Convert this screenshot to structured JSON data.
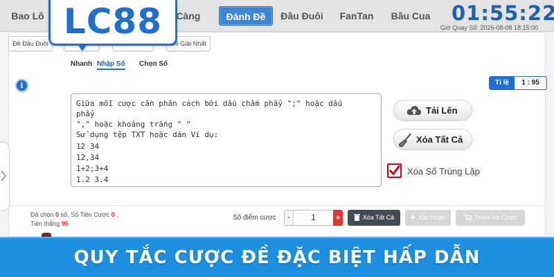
{
  "nav": {
    "tabs": [
      "Bao Lô",
      "3 Càng",
      "Đánh Đề",
      "Đầu Đuôi",
      "FanTan",
      "Bầu Cua"
    ],
    "active_tab": "Đánh Đề"
  },
  "logo": {
    "text": "LC88"
  },
  "clock": {
    "countdown": "01:55:22",
    "draw_time": "Giờ Quay Số: 2026-08-08 18:15:00"
  },
  "bet_subtabs": [
    "Đề Đầu Đuôi",
    "",
    "",
    "Đề Giải Nhất"
  ],
  "input_modes": {
    "items": [
      "Nhanh",
      "Nhập Số",
      "Chọn Số"
    ],
    "active": "Nhập Số"
  },
  "ratio": {
    "label": "Tỉ lệ",
    "value": "1 : 95"
  },
  "textarea": {
    "lines": [
      "Giữa mỗi cược cần phân cách bởi dấu chấm phẩy \";\" hoặc dấu",
      "phẩy",
      "\",\" hoặc khoảng trắng \" \"",
      "Sử dụng tệp TXT hoặc dán Ví dụ:",
      "12 34",
      "12,34",
      "1+2;3+4",
      "1.2 3.4"
    ]
  },
  "actions": {
    "upload_label": "Tải Lên",
    "clear_all_label": "Xóa Tất Cả",
    "remove_duplicates_label": "Xóa Số Trùng Lặp",
    "remove_duplicates_checked": true
  },
  "stats": {
    "selected_label": "Đã chọn",
    "selected_value": "0",
    "selected_unit": "số,",
    "bet_amount_label": "Số Tiền Cược",
    "bet_amount_value": "0",
    "bet_amount_sep": ",",
    "winnings_label": "Tiền thắng",
    "winnings_value": "95"
  },
  "bet_points": {
    "label": "Số điểm cược",
    "minus": "-",
    "value": "1",
    "plus": "+"
  },
  "bottom_buttons": {
    "clear_all": "Xóa Tất Cả",
    "confirm": "Xác Nhận",
    "add_to_cart": "Thêm Vé Cược"
  },
  "banner": {
    "text": "QUY TẮC CƯỢC ĐỀ ĐẶC BIỆT HẤP DẪN"
  },
  "colors": {
    "primary_blue": "#1f6fd1",
    "active_tab": "#3d86d6",
    "banner": "#1d8fe0",
    "accent_red": "#e8332a",
    "checkbox_red": "#d0021b"
  }
}
